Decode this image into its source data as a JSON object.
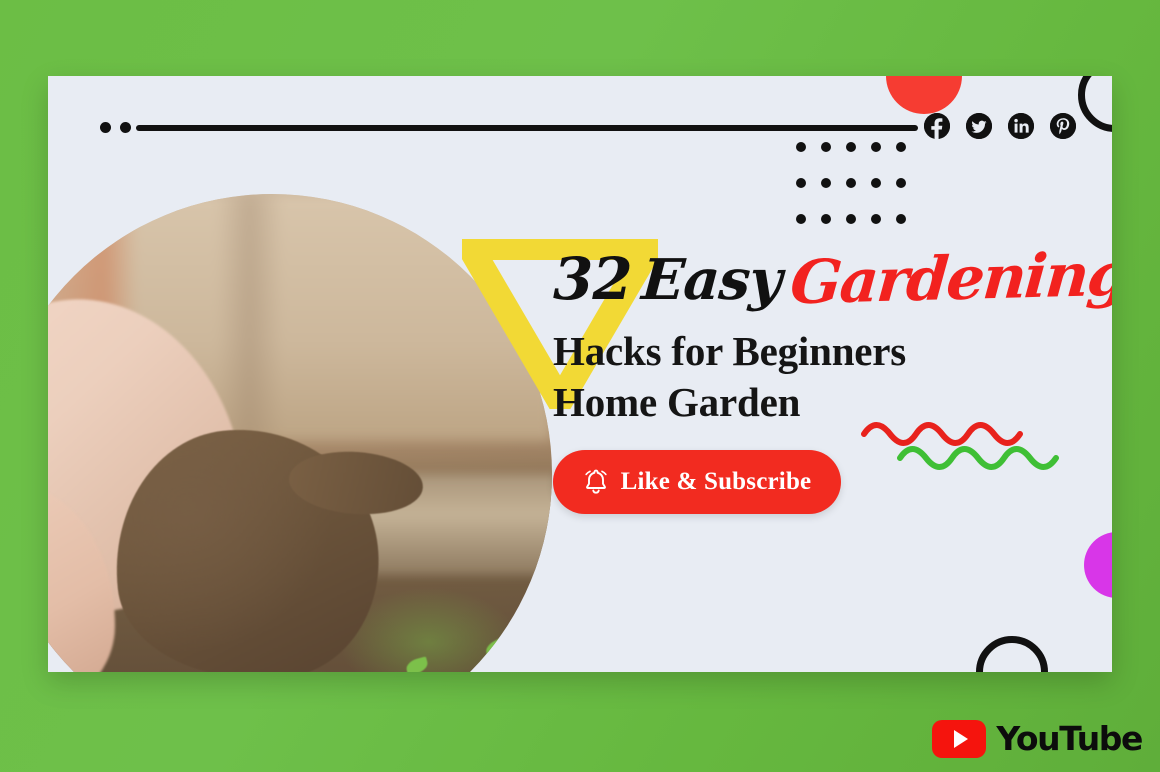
{
  "background": {
    "color": "#6cbe45"
  },
  "card": {
    "bg_color": "#e8ecf3"
  },
  "decor": {
    "red_circle_color": "#f63c32",
    "purple_circle_color": "#d836e8",
    "ring_color": "#111111",
    "dot_color": "#111111",
    "rule_color": "#111111",
    "triangle_color": "#f2d935",
    "squiggle_red": "#e8221c",
    "squiggle_green": "#3fbf35",
    "dot_grid": {
      "columns": 5,
      "rows": 3
    },
    "rule_dots": 2
  },
  "social": {
    "items": [
      {
        "name": "facebook",
        "glyph": "f"
      },
      {
        "name": "twitter",
        "glyph": "t"
      },
      {
        "name": "linkedin",
        "glyph": "in"
      },
      {
        "name": "pinterest",
        "glyph": "P"
      }
    ]
  },
  "headline": {
    "number": "32",
    "word_black": "Easy",
    "word_red": "Gardening",
    "line2": "Hacks for Beginners",
    "line3": "Home Garden",
    "red_color": "#f2221f",
    "black_color": "#111111"
  },
  "cta": {
    "label": "Like & Subscribe",
    "icon": "bell-icon",
    "bg_color": "#f22b20",
    "text_color": "#ffffff"
  },
  "photo": {
    "alt": "hands holding dark garden soil with seedlings",
    "shape": "circle"
  },
  "youtube": {
    "wordmark": "YouTube",
    "play_color": "#f5140d",
    "text_color": "#0c0c0c"
  }
}
